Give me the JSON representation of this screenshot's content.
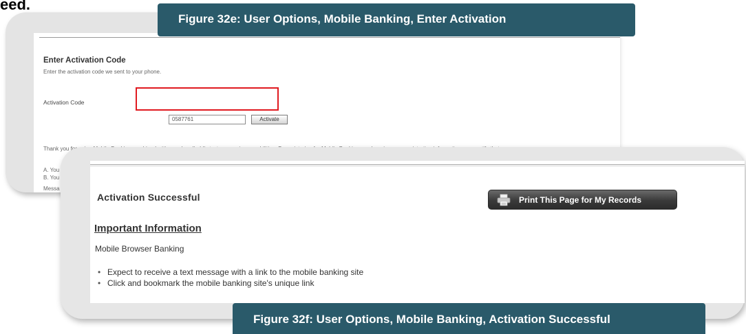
{
  "top_fragment": "eed.",
  "caption_e": "Figure 32e: User Options, Mobile Banking, Enter Activation",
  "caption_f": "Figure 32f: User Options, Mobile Banking, Activation Successful",
  "enter_activation": {
    "title": "Enter Activation Code",
    "subtitle": "Enter the activation code we sent to your phone.",
    "code_label": "Activation Code",
    "code_value": "0587761",
    "activate_button": "Activate",
    "terms_text": "Thank you for using Mobile Banking combined with your handheld's text messaging capabilities. By registering for Mobile Banking, or changing your registration information, you certify that:",
    "list_a": "A.  You are the account holder, or",
    "list_b": "B.  You ha",
    "trailing": "Messa"
  },
  "activation_successful": {
    "title": "Activation Successful",
    "print_button": "Print This Page for My Records",
    "important_heading": "Important Information",
    "subheading": "Mobile Browser Banking",
    "bullets": [
      "Expect to receive a text message with a link to the mobile banking site",
      "Click and bookmark the mobile banking site's unique link"
    ]
  },
  "colors": {
    "caption_background": "#2a5a6a",
    "highlight_border": "#e0191f",
    "panel_background": "#e4e4e4",
    "print_button_background": "#3a3a3a"
  },
  "icons": [
    "printer-icon"
  ]
}
